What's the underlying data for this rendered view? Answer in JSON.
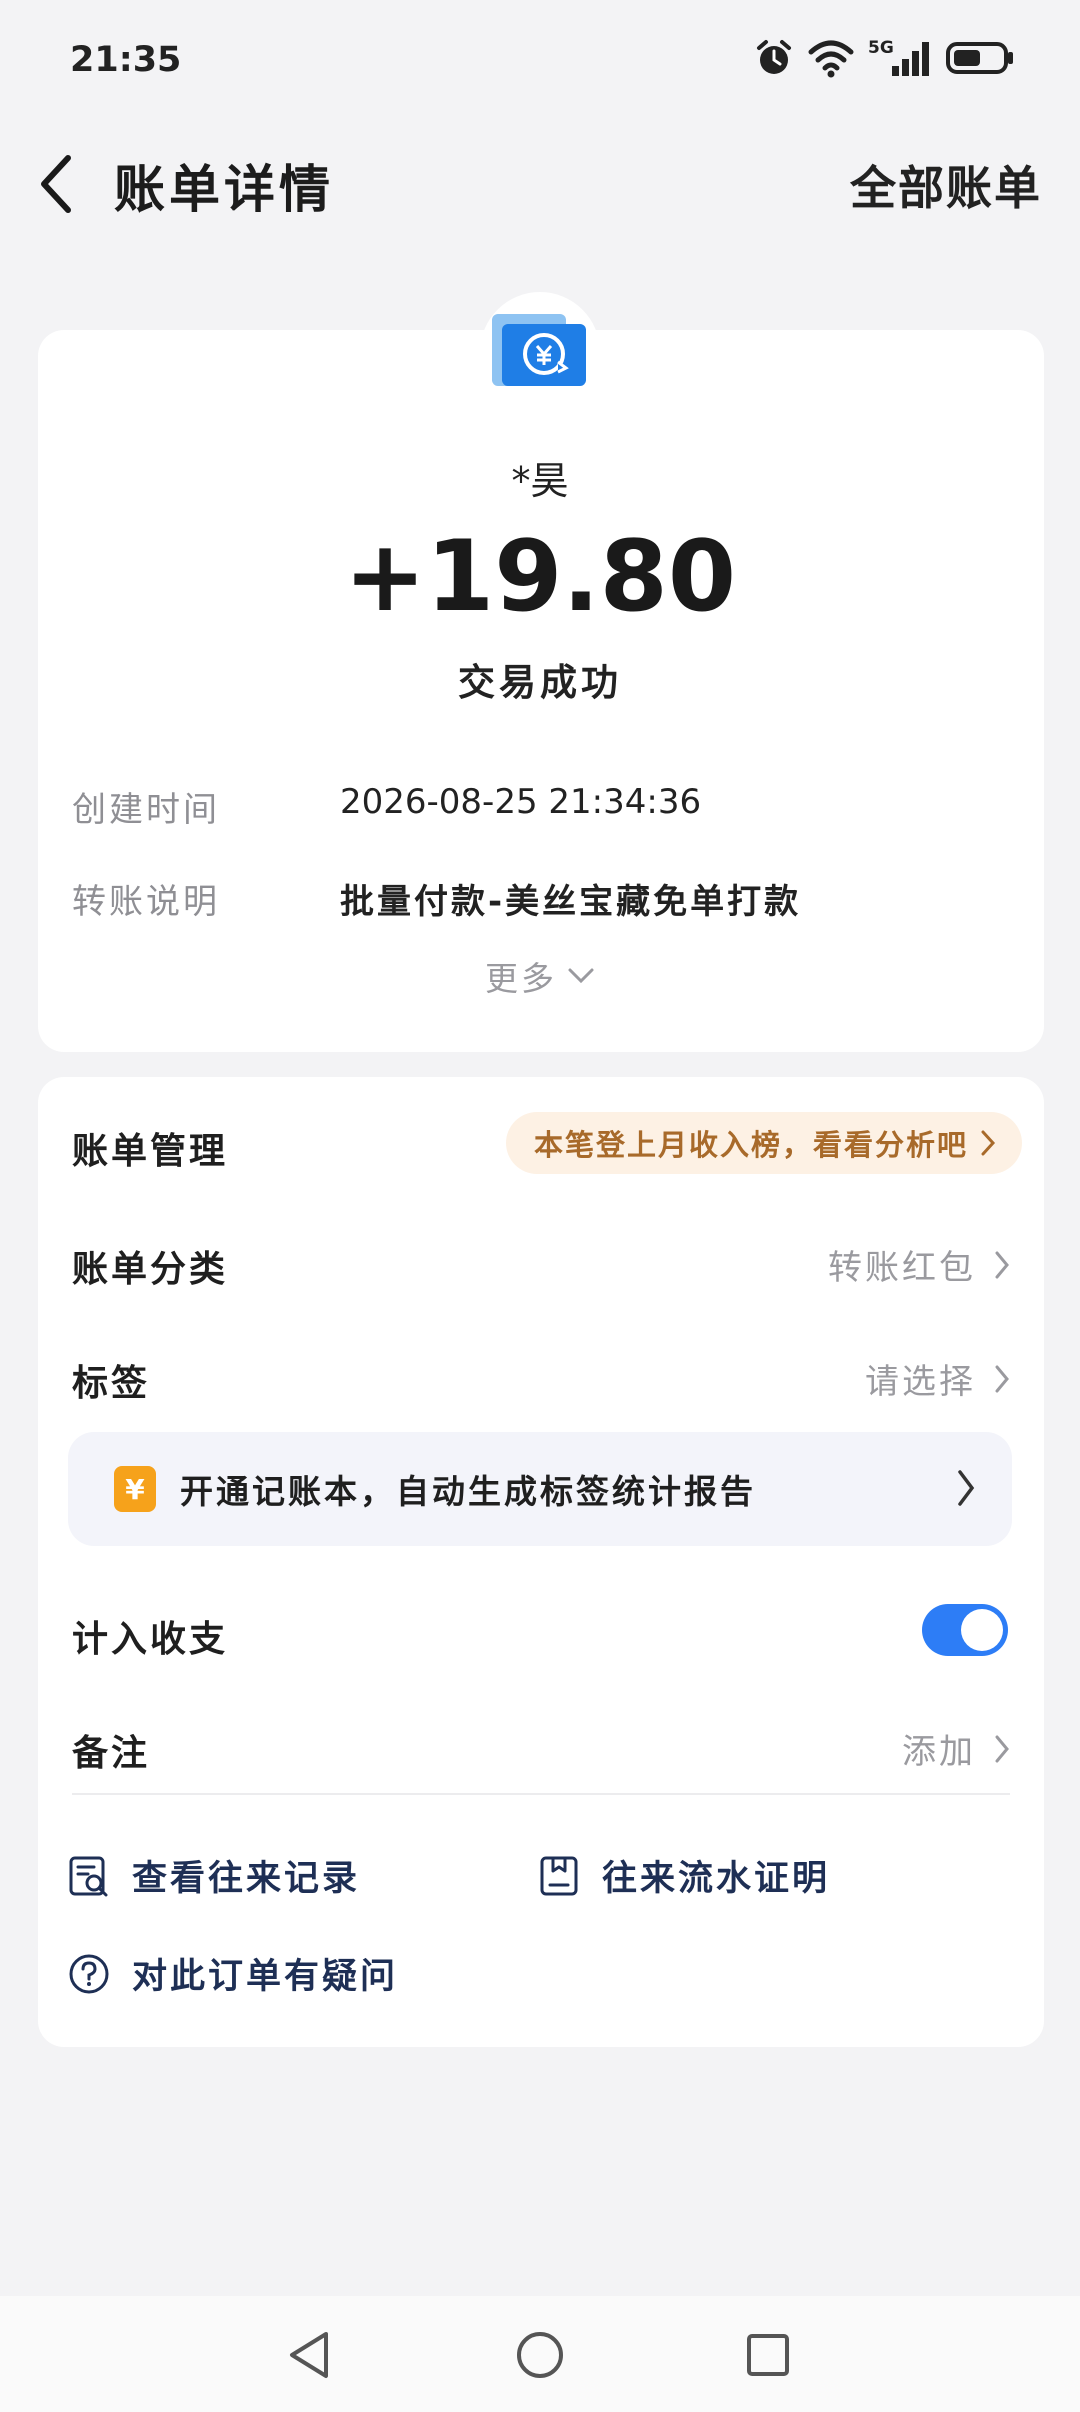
{
  "status_bar": {
    "time": "21:35",
    "network": "5G",
    "icons": [
      "alarm-icon",
      "wifi-icon",
      "cellular-signal-icon",
      "battery-icon"
    ]
  },
  "nav": {
    "title": "账单详情",
    "right_label": "全部账单",
    "back_icon": "chevron-left-icon"
  },
  "transaction": {
    "icon": "yuan-transfer-icon",
    "payer": "*昊",
    "amount": "+19.80",
    "status": "交易成功",
    "details": [
      {
        "label": "创建时间",
        "value": "2026-08-25 21:34:36"
      },
      {
        "label": "转账说明",
        "value": "批量付款-美丝宝藏免单打款"
      }
    ],
    "more_label": "更多"
  },
  "management": {
    "title": "账单管理",
    "income_pill": "本笔登上月收入榜，看看分析吧",
    "rows": [
      {
        "label": "账单分类",
        "value": "转账红包"
      },
      {
        "label": "标签",
        "value": "请选择"
      }
    ],
    "promo": {
      "icon_glyph": "¥",
      "text": "开通记账本，自动生成标签统计报告"
    },
    "toggle_row": {
      "label": "计入收支",
      "enabled": true
    },
    "note_row": {
      "label": "备注",
      "value": "添加"
    },
    "links": [
      {
        "icon": "search-record-icon",
        "label": "查看往来记录"
      },
      {
        "icon": "document-proof-icon",
        "label": "往来流水证明"
      },
      {
        "icon": "question-icon",
        "label": "对此订单有疑问"
      }
    ]
  },
  "colors": {
    "background": "#f3f3f5",
    "accent_blue": "#2d7df6",
    "pill_bg": "#fdf1e4",
    "pill_text": "#a86a2a",
    "link_text": "#1e2f55"
  },
  "navbar": {
    "icons": [
      "back-triangle-icon",
      "home-circle-icon",
      "recents-square-icon"
    ]
  }
}
